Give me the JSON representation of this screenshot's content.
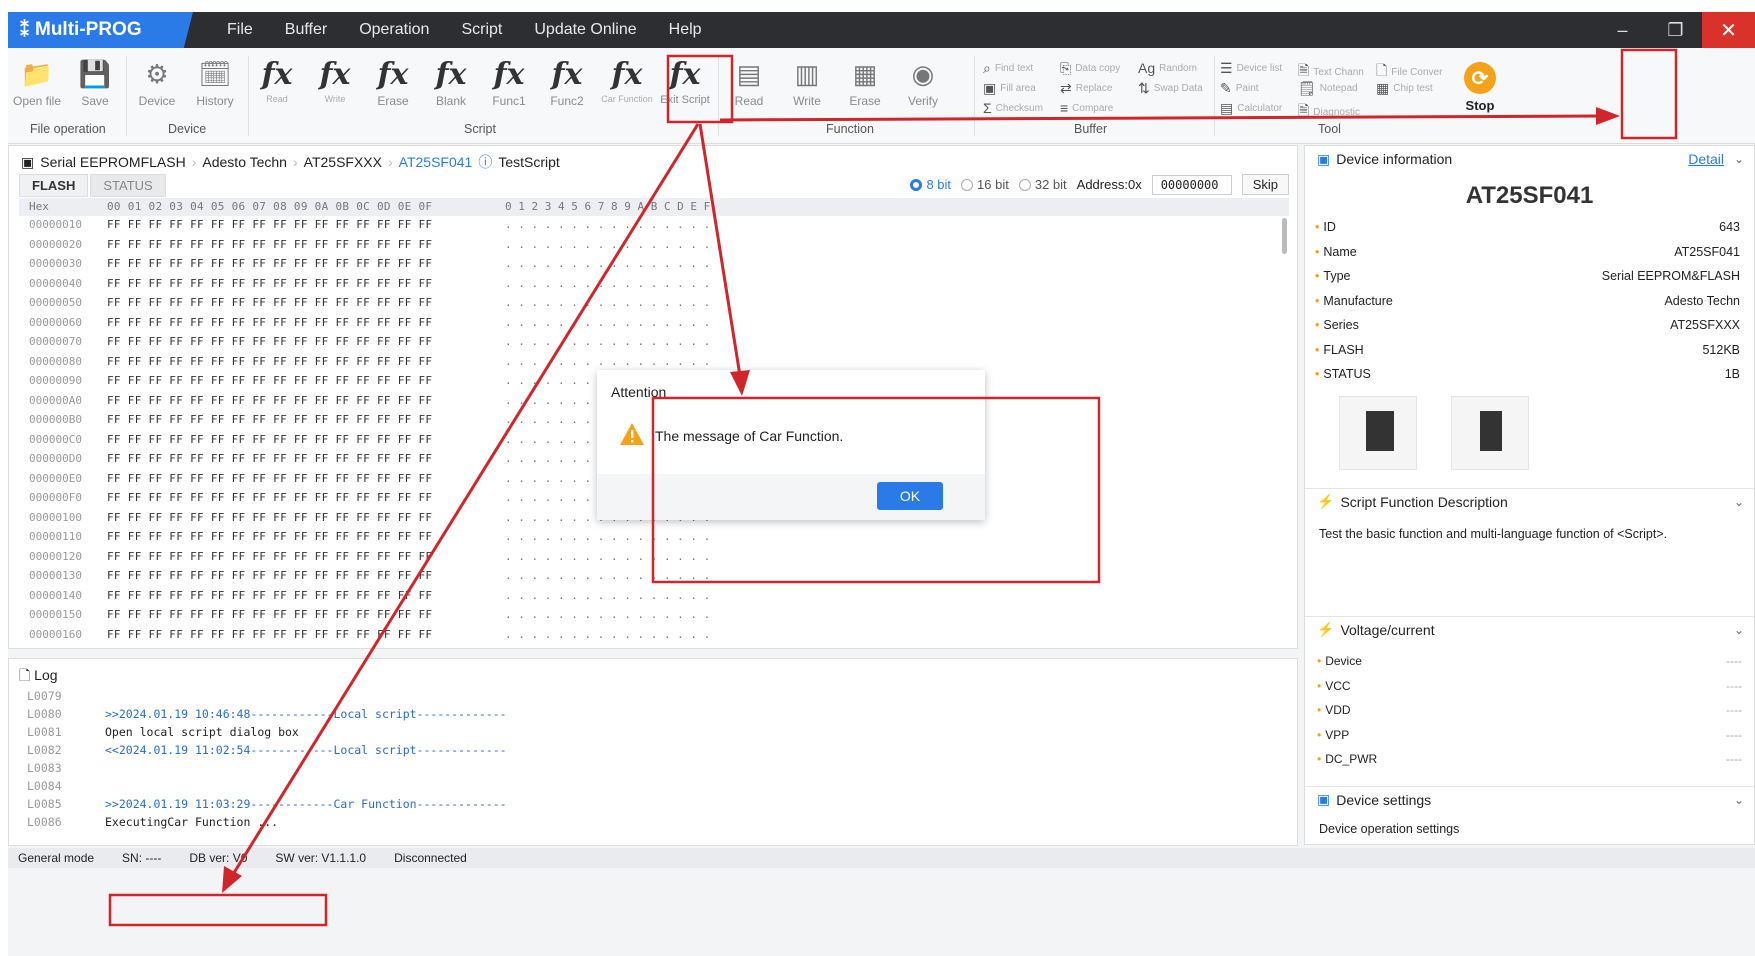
{
  "app": {
    "title": "Multi-PROG"
  },
  "menu": [
    "File",
    "Buffer",
    "Operation",
    "Script",
    "Update Online",
    "Help"
  ],
  "window": {
    "min": "–",
    "restore": "❐",
    "close": "✕"
  },
  "ribbon": {
    "file": {
      "open": "Open file",
      "save": "Save",
      "group": "File operation"
    },
    "device": {
      "device": "Device",
      "history": "History",
      "group": "Device"
    },
    "script": {
      "read": "Read",
      "write": "Write",
      "erase": "Erase",
      "blank": "Blank",
      "func1": "Func1",
      "func2": "Func2",
      "car_function": "Car Function",
      "exit_script": "Exit Script",
      "group": "Script",
      "fx": "fx"
    },
    "function": {
      "read": "Read",
      "write": "Write",
      "erase": "Erase",
      "verify": "Verify",
      "group": "Function"
    },
    "buffer": {
      "find_text": "Find text",
      "data_copy": "Data copy",
      "random": "Random",
      "fill_area": "Fill area",
      "replace": "Replace",
      "swap_data": "Swap Data",
      "checksum": "Checksum",
      "compare": "Compare",
      "group": "Buffer"
    },
    "tool": {
      "device_list": "Device list",
      "text_chann": "Text Chann",
      "file_conver": "File Conver",
      "paint": "Paint",
      "notepad": "Notepad",
      "chip_test": "Chip test",
      "calculator": "Calculator",
      "diagnostic": "Diagnostic",
      "group": "Tool"
    },
    "stop": "Stop"
  },
  "breadcrumb": [
    "Serial EEPROMFLASH",
    "Adesto Techn",
    "AT25SFXXX",
    "AT25SF041",
    "TestScript"
  ],
  "tabs": [
    "FLASH",
    "STATUS"
  ],
  "view": {
    "bit8": "8 bit",
    "bit16": "16 bit",
    "bit32": "32 bit",
    "address_label": "Address:0x",
    "address": "00000000",
    "skip": "Skip"
  },
  "hex": {
    "head": "Hex",
    "cols": "00 01 02 03 04 05 06 07 08 09 0A 0B 0C 0D 0E 0F",
    "ascii_head": "0 1 2 3 4 5 6 7 8 9 A B C D E F",
    "data": "FF FF FF FF FF FF FF FF FF FF FF FF FF FF FF FF",
    "ascii": ". . . . . . . . . . . . . . . .",
    "addresses": [
      "00000010",
      "00000020",
      "00000030",
      "00000040",
      "00000050",
      "00000060",
      "00000070",
      "00000080",
      "00000090",
      "000000A0",
      "000000B0",
      "000000C0",
      "000000D0",
      "000000E0",
      "000000F0",
      "00000100",
      "00000110",
      "00000120",
      "00000130",
      "00000140",
      "00000150",
      "00000160"
    ]
  },
  "log": {
    "title": "Log",
    "lines": [
      {
        "n": "L0079",
        "t": ""
      },
      {
        "n": "L0080",
        "t": ">>2024.01.19 10:46:48------------Local script-------------"
      },
      {
        "n": "L0081",
        "t": "Open local script dialog box"
      },
      {
        "n": "L0082",
        "t": "<<2024.01.19 11:02:54------------Local script-------------"
      },
      {
        "n": "L0083",
        "t": ""
      },
      {
        "n": "L0084",
        "t": ""
      },
      {
        "n": "L0085",
        "t": ">>2024.01.19 11:03:29------------Car Function-------------"
      },
      {
        "n": "L0086",
        "t": "ExecutingCar Function ..."
      }
    ]
  },
  "device_info": {
    "header": "Device information",
    "detail": "Detail",
    "name": "AT25SF041",
    "props": [
      {
        "k": "ID",
        "v": "643"
      },
      {
        "k": "Name",
        "v": "AT25SF041"
      },
      {
        "k": "Type",
        "v": "Serial EEPROM&FLASH"
      },
      {
        "k": "Manufacture",
        "v": "Adesto Techn"
      },
      {
        "k": "Series",
        "v": "AT25SFXXX"
      },
      {
        "k": "FLASH",
        "v": "512KB"
      },
      {
        "k": "STATUS",
        "v": "1B"
      }
    ]
  },
  "script_desc": {
    "header": "Script Function Description",
    "text": "Test the basic function and multi-language function of <Script>."
  },
  "voltage": {
    "header": "Voltage/current",
    "rows": [
      {
        "k": "Device",
        "v": "----"
      },
      {
        "k": "VCC",
        "v": "----"
      },
      {
        "k": "VDD",
        "v": "----"
      },
      {
        "k": "VPP",
        "v": "----"
      },
      {
        "k": "DC_PWR",
        "v": "----"
      }
    ]
  },
  "device_settings": {
    "header": "Device settings",
    "sub": "Device operation settings"
  },
  "statusbar": {
    "mode": "General mode",
    "sn": "SN: ----",
    "db": "DB ver: V0",
    "sw": "SW ver: V1.1.1.0",
    "conn": "Disconnected"
  },
  "dialog": {
    "title": "Attention",
    "message": "The message of Car Function.",
    "ok": "OK"
  },
  "colors": {
    "accent": "#2a7be8",
    "annotation": "#d0252b",
    "stop": "#f5a21b",
    "title_bg": "#2c2e31"
  }
}
